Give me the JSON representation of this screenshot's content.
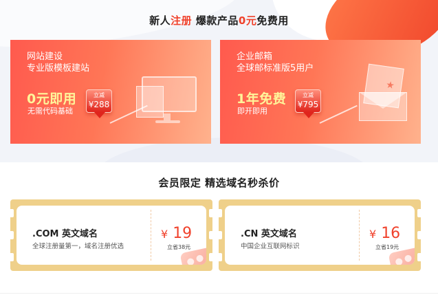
{
  "headings": {
    "new_user": {
      "part1": "新人",
      "part2": "注册",
      "part3": " 爆款产品",
      "part4": "0元",
      "part5": "免费用"
    },
    "member": "会员限定 精选域名秒杀价"
  },
  "promos": [
    {
      "title_line1": "网站建设",
      "title_line2": "专业版模板建站",
      "big_text": "0元即用",
      "sub_text": "无需代码基础",
      "badge_top": "立减",
      "badge_value": "¥288",
      "icon": "monitor-icon"
    },
    {
      "title_line1": "企业邮箱",
      "title_line2": "全球邮标准版5用户",
      "big_text": "1年免费",
      "sub_text": "即开即用",
      "badge_top": "立减",
      "badge_value": "¥795",
      "icon": "envelope-icon"
    }
  ],
  "coupons": [
    {
      "name": ".COM 英文域名",
      "desc": "全球注册量第一，域名注册优选",
      "currency": "¥",
      "price": "19",
      "save": "立省38元"
    },
    {
      "name": ".CN 英文域名",
      "desc": "中国企业互联网标识",
      "currency": "¥",
      "price": "16",
      "save": "立省19元"
    }
  ],
  "colors": {
    "accent": "#f0412b",
    "promo_gradient_start": "#ff5a4e",
    "promo_gradient_end": "#ffb28d",
    "promo_big_text": "#fff59a",
    "coupon_frame": "#efd08a"
  }
}
